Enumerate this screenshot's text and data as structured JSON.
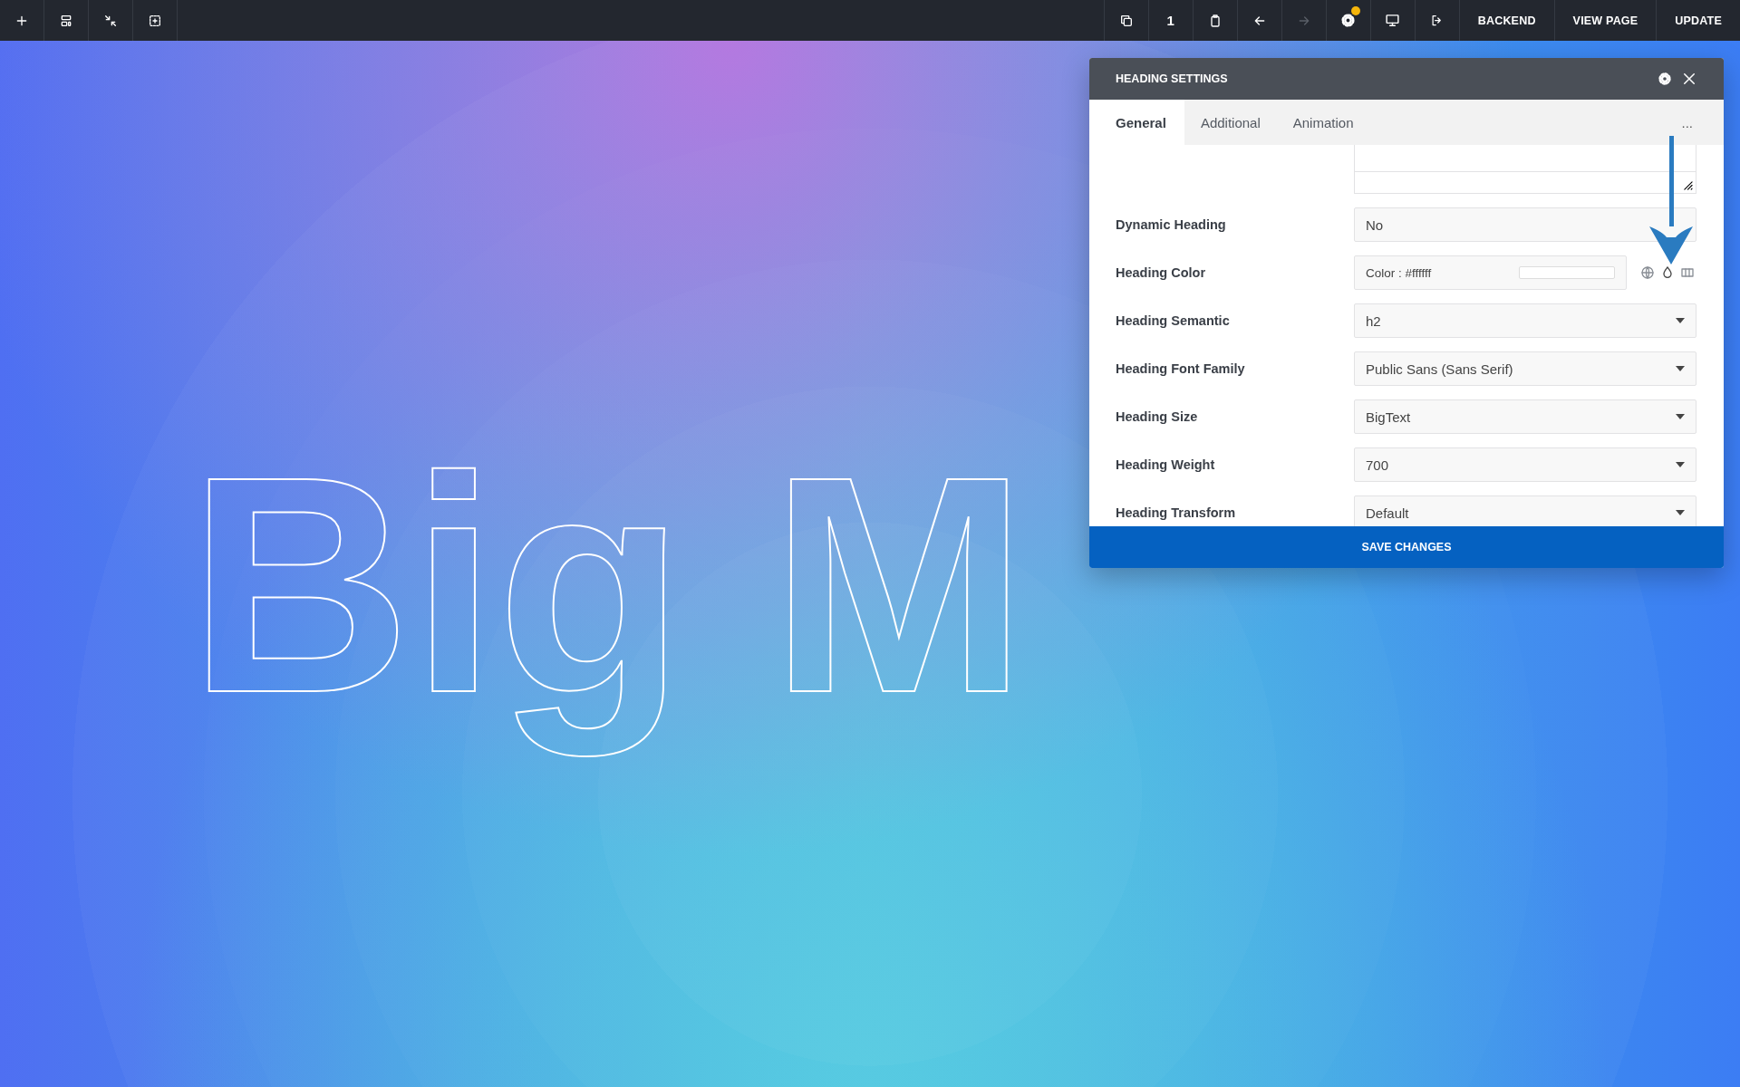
{
  "toolbar": {
    "page_count": "1",
    "redo_disabled": true,
    "settings_badge": true,
    "buttons": [
      "BACKEND",
      "VIEW PAGE",
      "UPDATE"
    ]
  },
  "canvas": {
    "heading": "Big M"
  },
  "dialog": {
    "title": "HEADING SETTINGS",
    "tabs": [
      {
        "label": "General",
        "selected": true
      },
      {
        "label": "Additional",
        "selected": false
      },
      {
        "label": "Animation",
        "selected": false
      }
    ],
    "more": "...",
    "fields": [
      {
        "kind": "textarea"
      },
      {
        "kind": "input",
        "label": "Dynamic Heading",
        "value": "No"
      },
      {
        "kind": "color",
        "label": "Heading Color",
        "value": "Color : #ffffff"
      },
      {
        "kind": "select",
        "label": "Heading Semantic",
        "value": "h2"
      },
      {
        "kind": "select",
        "label": "Heading Font Family",
        "value": "Public Sans (Sans Serif)"
      },
      {
        "kind": "select",
        "label": "Heading Size",
        "value": "BigText"
      },
      {
        "kind": "select",
        "label": "Heading Weight",
        "value": "700"
      },
      {
        "kind": "select",
        "label": "Heading Transform",
        "value": "Default"
      }
    ],
    "save": "SAVE CHANGES"
  }
}
